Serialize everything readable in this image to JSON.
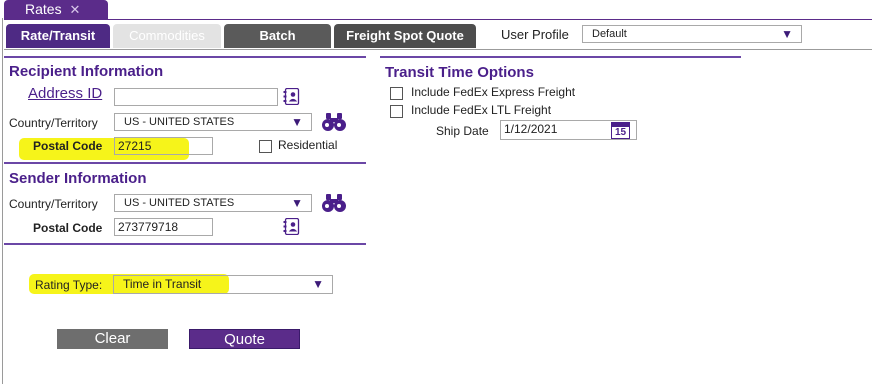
{
  "window_tab": {
    "title": "Rates",
    "close_glyph": "✕"
  },
  "tabs": [
    {
      "label": "Rate/Transit",
      "active": true
    },
    {
      "label": "Commodities",
      "disabled": true
    },
    {
      "label": "Batch"
    },
    {
      "label": "Freight Spot Quote"
    }
  ],
  "user_profile": {
    "label": "User Profile",
    "value": "Default"
  },
  "recipient": {
    "title": "Recipient Information",
    "address_id_label": "Address ID",
    "address_id_value": "",
    "country_label": "Country/Territory",
    "country_value": "US - UNITED STATES",
    "postal_label": "Postal Code",
    "postal_value": "27215",
    "residential_label": "Residential",
    "residential_checked": false
  },
  "sender": {
    "title": "Sender Information",
    "country_label": "Country/Territory",
    "country_value": "US - UNITED STATES",
    "postal_label": "Postal Code",
    "postal_value": "273779718"
  },
  "rating": {
    "label": "Rating Type:",
    "value": "Time in Transit"
  },
  "transit": {
    "title": "Transit Time Options",
    "express_label": "Include FedEx Express Freight",
    "express_checked": false,
    "ltl_label": "Include FedEx LTL Freight",
    "ltl_checked": false,
    "ship_date_label": "Ship Date",
    "ship_date_value": "1/12/2021",
    "calendar_day": "15"
  },
  "buttons": {
    "clear": "Clear",
    "quote": "Quote"
  },
  "colors": {
    "brand_purple": "#4e2a84",
    "highlight": "#f6f41a",
    "tab_gray": "#5a5a5a"
  },
  "icons": [
    "close-icon",
    "address-book-icon",
    "binoculars-icon",
    "calendar-icon",
    "dropdown-arrow-icon"
  ]
}
